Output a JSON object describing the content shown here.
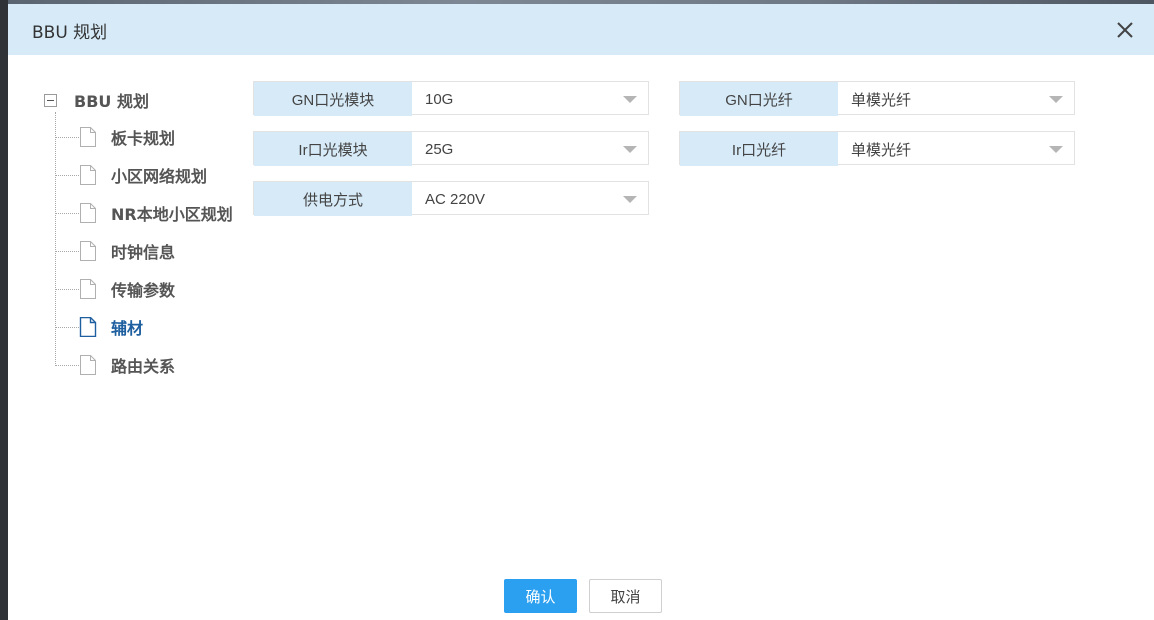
{
  "dialog": {
    "title": "BBU 规划"
  },
  "tree": {
    "root_label": "BBU 规划",
    "items": [
      {
        "label": "板卡规划",
        "active": false
      },
      {
        "label": "小区网络规划",
        "active": false
      },
      {
        "label": "NR本地小区规划",
        "active": false
      },
      {
        "label": "时钟信息",
        "active": false
      },
      {
        "label": "传输参数",
        "active": false
      },
      {
        "label": "辅材",
        "active": true
      },
      {
        "label": "路由关系",
        "active": false
      }
    ]
  },
  "form": {
    "gn_module": {
      "label": "GN口光模块",
      "value": "10G"
    },
    "gn_fiber": {
      "label": "GN口光纤",
      "value": "单模光纤"
    },
    "ir_module": {
      "label": "Ir口光模块",
      "value": "25G"
    },
    "ir_fiber": {
      "label": "Ir口光纤",
      "value": "单模光纤"
    },
    "power": {
      "label": "供电方式",
      "value": "AC 220V"
    }
  },
  "footer": {
    "confirm_label": "确认",
    "cancel_label": "取消"
  },
  "colors": {
    "header_bg": "#d6eaf8",
    "label_bg": "#d6eaf8",
    "primary": "#2b9ff0",
    "active_tree_text": "#1e5fa0"
  }
}
